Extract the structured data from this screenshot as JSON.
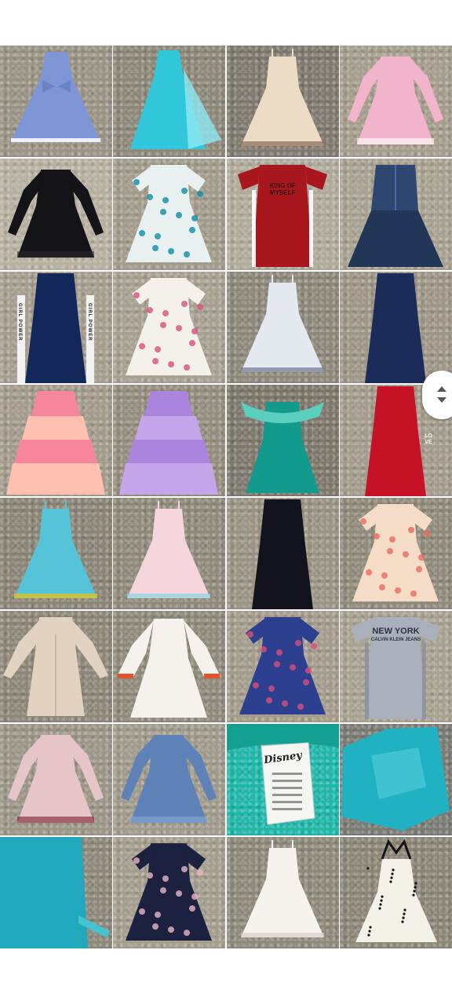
{
  "tiles": [
    {
      "id": "r1c1",
      "bg": "#9a9384",
      "dress": "#7f96d6",
      "trim": "#eef0ff",
      "kind": "dress-bow"
    },
    {
      "id": "r1c2",
      "bg": "#8c8778",
      "dress": "#2fc7d9",
      "trim": "#8ee9f2",
      "kind": "dress-cape"
    },
    {
      "id": "r1c3",
      "bg": "#7e786d",
      "dress": "#ecdcc6",
      "trim": "#8a6b55",
      "kind": "dress-strap"
    },
    {
      "id": "r1c4",
      "bg": "#a49c8c",
      "dress": "#f2b4cb",
      "trim": "#ffffff",
      "kind": "dress-longsleeve"
    },
    {
      "id": "r2c1",
      "bg": "#b7b0a0",
      "dress": "#141317",
      "trim": "#2a2830",
      "kind": "dress-longsleeve"
    },
    {
      "id": "r2c2",
      "bg": "#a29b8b",
      "dress": "#e8f0f0",
      "trim": "#0e8fa8",
      "kind": "dress-short"
    },
    {
      "id": "r2c3",
      "bg": "#b0aa9a",
      "dress": "#a8161e",
      "trim": "#ffffff",
      "kind": "dress-tee",
      "label": "KING OF\nMYSELF"
    },
    {
      "id": "r2c4",
      "bg": "#a8a190",
      "dress": "#2f4670",
      "trim": "#4a6aa0",
      "kind": "dress-denim"
    },
    {
      "id": "r3c1",
      "bg": "#a59e8e",
      "dress": "#13275b",
      "trim": "#f2f2f2",
      "kind": "dress-tank",
      "side": "GIRL POWER"
    },
    {
      "id": "r3c2",
      "bg": "#a7a090",
      "dress": "#f4f1ea",
      "trim": "#d8507e",
      "kind": "dress-short"
    },
    {
      "id": "r3c3",
      "bg": "#8d877a",
      "dress": "#e4e8ef",
      "trim": "#6d7893",
      "kind": "dress-strap"
    },
    {
      "id": "r3c4",
      "bg": "#9d9585",
      "dress": "#1c2c58",
      "trim": "#e8ecf6",
      "kind": "dress-tank"
    },
    {
      "id": "r4c1",
      "bg": "#a29a8a",
      "dress": "#f7869c",
      "trim": "#ffc0b2",
      "kind": "dress-tiered"
    },
    {
      "id": "r4c2",
      "bg": "#948d7e",
      "dress": "#ab84dd",
      "trim": "#c5a6ea",
      "kind": "dress-tiered"
    },
    {
      "id": "r4c3",
      "bg": "#7d776b",
      "dress": "#129a8c",
      "trim": "#5bcfbe",
      "kind": "dress-ruffle"
    },
    {
      "id": "r4c4",
      "bg": "#a39b8b",
      "dress": "#c61226",
      "trim": "#f0f0f0",
      "kind": "dress-tank",
      "label": "LOVE"
    },
    {
      "id": "r5c1",
      "bg": "#8a8476",
      "dress": "#55c3d8",
      "trim": "#f1c40f",
      "kind": "dress-strap"
    },
    {
      "id": "r5c2",
      "bg": "#8f897a",
      "dress": "#f6d6dd",
      "trim": "#8ed6df",
      "kind": "dress-strap"
    },
    {
      "id": "r5c3",
      "bg": "#9a9383",
      "dress": "#12131c",
      "trim": "#2b2c38",
      "kind": "dress-tank"
    },
    {
      "id": "r5c4",
      "bg": "#8f8979",
      "dress": "#f4dcc6",
      "trim": "#ea6a60",
      "kind": "dress-short"
    },
    {
      "id": "r6c1",
      "bg": "#8d8677",
      "dress": "#e2d2c2",
      "trim": "#c9b9a8",
      "kind": "coat"
    },
    {
      "id": "r6c2",
      "bg": "#8f897a",
      "dress": "#f5f1ec",
      "trim": "#e0542e",
      "kind": "dress-bell"
    },
    {
      "id": "r6c3",
      "bg": "#a39b8b",
      "dress": "#2d3f8f",
      "trim": "#d94f7a",
      "kind": "dress-short"
    },
    {
      "id": "r6c4",
      "bg": "#a8a190",
      "dress": "#a9afbb",
      "trim": "#8c93a1",
      "kind": "dress-tee",
      "label": "NEW YORK",
      "sublabel": "CALVIN KLEIN JEANS"
    },
    {
      "id": "r7c1",
      "bg": "#9b9586",
      "dress": "#e6c5c8",
      "trim": "#7a1e2e",
      "kind": "dress-longsleeve"
    },
    {
      "id": "r7c2",
      "bg": "#a09a8b",
      "dress": "#5e82b8",
      "trim": "#8aa6d0",
      "kind": "dress-longsleeve"
    },
    {
      "id": "r7c3",
      "bg": "#1cb7a8",
      "dress": "#f5f5f2",
      "trim": "#1cb7a8",
      "kind": "tag",
      "label": "Disney"
    },
    {
      "id": "r7c4",
      "bg": "#7a7a74",
      "dress": "#20b1c2",
      "trim": "#5fd4df",
      "kind": "fabric"
    },
    {
      "id": "r8c1",
      "bg": "#8d877a",
      "dress": "#21a8bd",
      "trim": "#44c4d2",
      "kind": "fabric-side"
    },
    {
      "id": "r8c2",
      "bg": "#a49d8d",
      "dress": "#1c2140",
      "trim": "#e9b6c6",
      "kind": "dress-short"
    },
    {
      "id": "r8c3",
      "bg": "#8e887a",
      "dress": "#f6f3ee",
      "trim": "#d5d0c8",
      "kind": "dress-strap"
    },
    {
      "id": "r8c4",
      "bg": "#8b8576",
      "dress": "#f4f1e9",
      "trim": "#141414",
      "kind": "dress-halter"
    }
  ]
}
